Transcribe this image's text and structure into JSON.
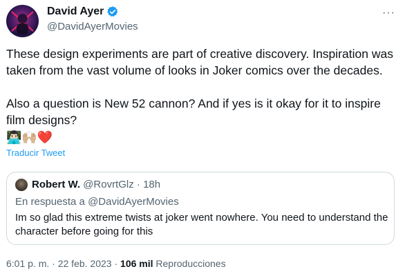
{
  "author": {
    "name": "David Ayer",
    "handle": "@DavidAyerMovies",
    "verified": true
  },
  "more_menu": "···",
  "tweet": {
    "paragraphs": [
      "These design experiments are part of creative discovery. Inspiration was taken from the vast volume of looks in Joker comics over the decades.",
      "Also a question is New 52 cannon? And if yes is it okay for it to inspire film designs?"
    ],
    "emojis": [
      "👨🏻‍💻",
      "🙌🏼",
      "❤️"
    ],
    "translate_label": "Traducir Tweet"
  },
  "quoted": {
    "name": "Robert W.",
    "handle": "@RovrtGlz",
    "separator": "·",
    "time": "18h",
    "reply_to": "En respuesta a @DavidAyerMovies",
    "text": "Im so glad this extreme twists at joker went nowhere. You need to understand the character before going for this"
  },
  "footer": {
    "time": "6:01 p. m.",
    "sep1": "·",
    "date": "22 feb. 2023",
    "sep2": "·",
    "views_count": "106 mil",
    "views_label": "Reproducciones"
  },
  "colors": {
    "accent": "#1d9bf0",
    "secondary_text": "#536471",
    "border": "#cfd9de"
  }
}
